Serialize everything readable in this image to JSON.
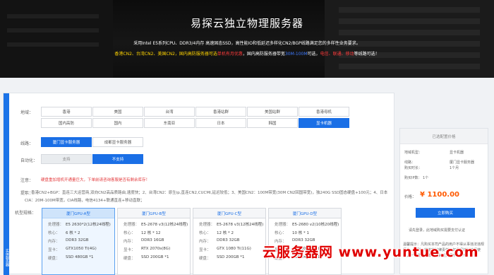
{
  "hero": {
    "title": "易探云独立物理服务器",
    "subtitle": "采用Intel E5系列CPU、DDR3/4内存 高速固态SSD，高性能IO和低延迟多样化CN2/BGP线路满足您的多样性业务要求。",
    "line2": {
      "part1": "香港CN2、台湾CN2、美国CN2，国内高防服务器可选",
      "part2": "单机有月优惠",
      "part3": "，国内高防服务器带宽",
      "part4": "30M-100M",
      "part5": "可选，",
      "part6": "电信、联通、移动",
      "part7": "等线路可选！"
    }
  },
  "left_strip": {
    "label": "实体服务器"
  },
  "region": {
    "label": "地域：",
    "options": [
      "香港",
      "美国",
      "台湾",
      "香港站群",
      "美国站群",
      "香港母机",
      "国内高防",
      "国内",
      "东南亚",
      "日本",
      "韩国",
      "显卡机器"
    ],
    "selected": "显卡机器"
  },
  "line": {
    "label": "线路：",
    "options": [
      "厦门显卡服务器",
      "成都显卡服务器"
    ],
    "selected": "厦门显卡服务器"
  },
  "auto_renew": {
    "label": "自动化：",
    "options": [
      "支持",
      "不支持"
    ],
    "selected": "不支持"
  },
  "notice": {
    "label": "注意：",
    "text": "硬盘重加增机开通量巨大，下单前请咨询客服是否有剩余库存！"
  },
  "hint": {
    "label": "提示：",
    "text": "1、香港CN2+BGP：直连三大运营商,双向CN2高品质路由,速度快；2、台湾CN2：原生ip,直连CN2,CUCMI,延迟较低；3、美国CN2：100M带宽(30M CN2回国带宽)，独240G SSD固态硬盘+100元；4、日本CIA：20M-100M带宽，CIA线路，电信4134+联通直连+移动直联；"
  },
  "models": {
    "label": "机型规格：",
    "spec_labels": {
      "cpu": "处理器：",
      "cores": "核心：",
      "ram": "内存：",
      "gpu": "显卡：",
      "disk": "硬盘："
    },
    "cards": [
      {
        "name": "厦门GPU-A型",
        "cpu": "E5 2630*2(12核24线程)",
        "cores": "6 核 * 2",
        "ram": "DDR3 32GB",
        "gpu": "GTX1050 Ti(4G)",
        "disk": "SSD 480GB *1"
      },
      {
        "name": "厦门GPU-B型",
        "cpu": "E5-2678 v3(12核24线程)",
        "cores": "12 核 * 12",
        "ram": "DDR3 16GB",
        "gpu": "RTX 2070s(8G)",
        "disk": "SSD 200GB *1"
      },
      {
        "name": "厦门GPU-C型",
        "cpu": "E5-2678 v3(12核24线程)",
        "cores": "12 核 * 2",
        "ram": "DDR3 32GB",
        "gpu": "GTX 1080 Ti(11G)",
        "disk": "SSD 200GB *1"
      },
      {
        "name": "厦门GPU-D型",
        "cpu": "E5-2680 v2(10核20线程)",
        "cores": "10 核 * 1",
        "ram": "DDR3 32GB",
        "gpu": "RTX 3080(8G)",
        "disk": "SSD 240GB *1"
      }
    ],
    "selected_index": 0
  },
  "sidebar": {
    "header": "已选配置价格",
    "rows": [
      {
        "key": "地域机型：",
        "value": "显卡机器"
      },
      {
        "key": "线路：",
        "value": "厦门显卡服务器"
      },
      {
        "key": "购买时长：",
        "value": "1个月"
      },
      {
        "key": "购买IP数：",
        "value": "1个"
      }
    ],
    "price_label": "价格：",
    "price": "¥ 1100.00",
    "buy_label": "立即购买",
    "login_note": "请先登录，此地域购买需要支付认证",
    "warm_note": "温馨提示：凡购买本司产品的用户不得从事违法违规行为，否则，将追究法律责任。如发现违法违规使用，一经发现立即永久关闭，概不退款！"
  },
  "watermark": {
    "text": "云服务器网 www.yuntue.com"
  },
  "colors": {
    "accent": "#1a6fe6",
    "price": "#ff5a00",
    "notice": "#e4393c",
    "watermark": "#e00000"
  }
}
